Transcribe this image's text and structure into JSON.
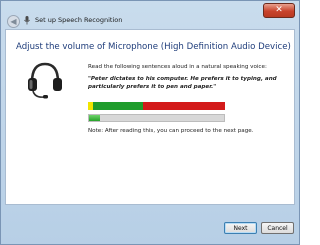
{
  "window": {
    "title": "Set up Speech Recognition",
    "close_label": "✕"
  },
  "icons": {
    "back": "back-arrow-icon",
    "titlebar": "microphone-icon",
    "headset": "headset-icon"
  },
  "main": {
    "heading": "Adjust the volume of Microphone (High Definition Audio Device)",
    "instruction": "Read the following sentences aloud in a natural speaking voice:",
    "quote": "\"Peter dictates to his computer. He prefers it to typing, and particularly prefers it to pen and paper.\"",
    "meter": {
      "zones": [
        {
          "name": "low",
          "color": "#f1e500",
          "fraction": 0.04
        },
        {
          "name": "good",
          "color": "#1f9c2c",
          "fraction": 0.36
        },
        {
          "name": "loud",
          "color": "#d31a1a",
          "fraction": 0.6
        }
      ]
    },
    "progress": {
      "fraction": 0.08,
      "color": "#27a32a"
    },
    "note": "Note: After reading this, you can proceed to the next page."
  },
  "footer": {
    "next_label": "Next",
    "cancel_label": "Cancel"
  }
}
